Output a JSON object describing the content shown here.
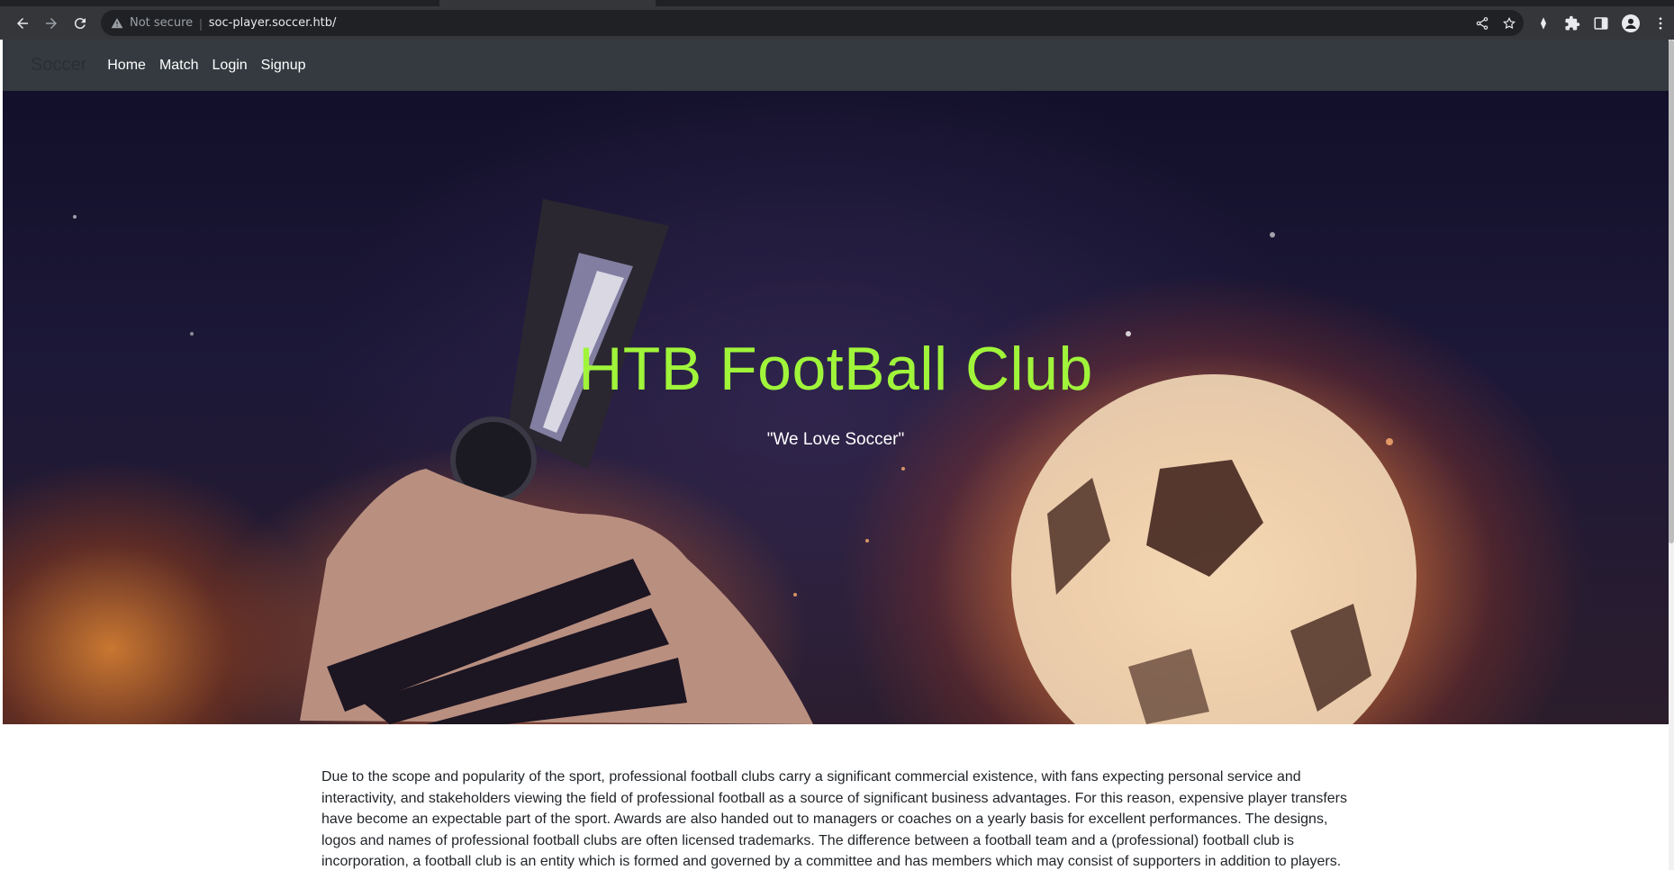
{
  "browser": {
    "security_label": "Not secure",
    "url": "soc-player.soccer.htb/",
    "icons": [
      "back-icon",
      "forward-icon",
      "reload-icon",
      "warning-icon",
      "share-icon",
      "star-icon",
      "extension-icon",
      "puzzle-icon",
      "sidepanel-icon",
      "profile-icon",
      "menu-icon"
    ]
  },
  "navbar": {
    "brand": "Soccer",
    "links": [
      "Home",
      "Match",
      "Login",
      "Signup"
    ]
  },
  "hero": {
    "title": "HTB FootBall Club",
    "subtitle": "\"We Love Soccer\"",
    "title_color": "#a0f53a"
  },
  "content": {
    "paragraph": "Due to the scope and popularity of the sport, professional football clubs carry a significant commercial existence, with fans expecting personal service and interactivity, and stakeholders viewing the field of professional football as a source of significant business advantages. For this reason, expensive player transfers have become an expectable part of the sport. Awards are also handed out to managers or coaches on a yearly basis for excellent performances. The designs, logos and names of professional football clubs are often licensed trademarks. The difference between a football team and a (professional) football club is incorporation, a football club is an entity which is formed and governed by a committee and has members which may consist of supporters in addition to players."
  }
}
